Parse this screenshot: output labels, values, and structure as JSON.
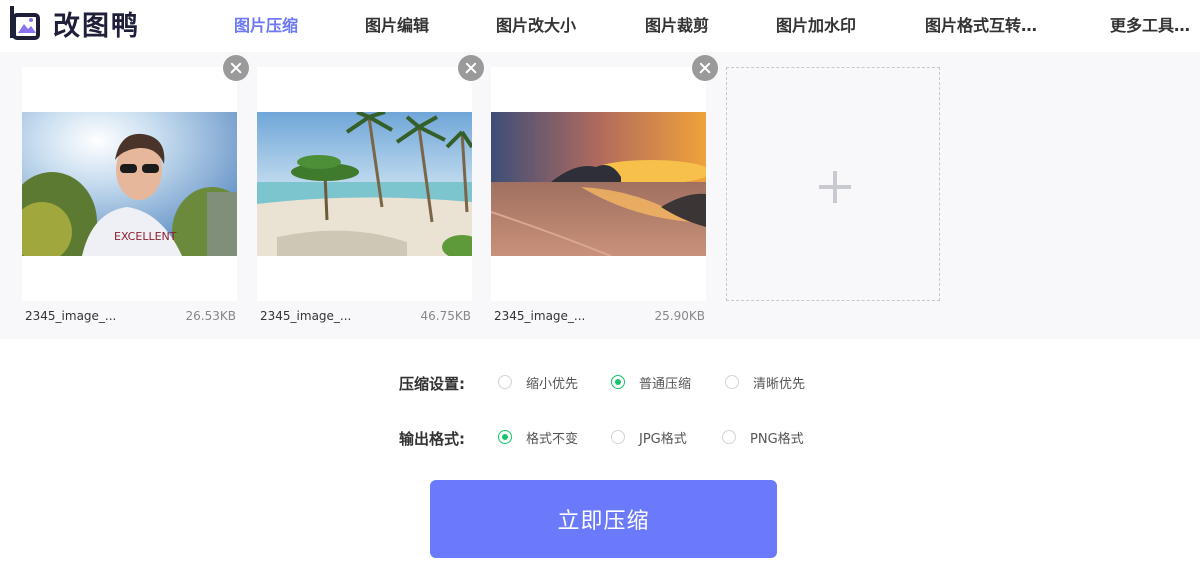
{
  "app": {
    "name": "改图鸭"
  },
  "nav": {
    "items": [
      {
        "label": "图片压缩",
        "active": true
      },
      {
        "label": "图片编辑",
        "active": false
      },
      {
        "label": "图片改大小",
        "active": false
      },
      {
        "label": "图片裁剪",
        "active": false
      },
      {
        "label": "图片加水印",
        "active": false
      },
      {
        "label": "图片格式互转…",
        "active": false
      },
      {
        "label": "更多工具…",
        "active": false
      }
    ]
  },
  "files": [
    {
      "name": "2345_image_...",
      "size": "26.53KB",
      "thumbnail": "portrait-outdoor-photo"
    },
    {
      "name": "2345_image_...",
      "size": "46.75KB",
      "thumbnail": "tropical-beach-photo"
    },
    {
      "name": "2345_image_...",
      "size": "25.90KB",
      "thumbnail": "sunset-beach-photo"
    }
  ],
  "compression": {
    "label": "压缩设置:",
    "options": [
      {
        "label": "缩小优先",
        "selected": false
      },
      {
        "label": "普通压缩",
        "selected": true
      },
      {
        "label": "清晰优先",
        "selected": false
      }
    ]
  },
  "output_format": {
    "label": "输出格式:",
    "options": [
      {
        "label": "格式不变",
        "selected": true
      },
      {
        "label": "JPG格式",
        "selected": false
      },
      {
        "label": "PNG格式",
        "selected": false
      }
    ]
  },
  "submit": {
    "label": "立即压缩"
  },
  "colors": {
    "accent": "#6b79fb",
    "nav_active": "#6c78f5",
    "radio_on": "#19c36b"
  }
}
